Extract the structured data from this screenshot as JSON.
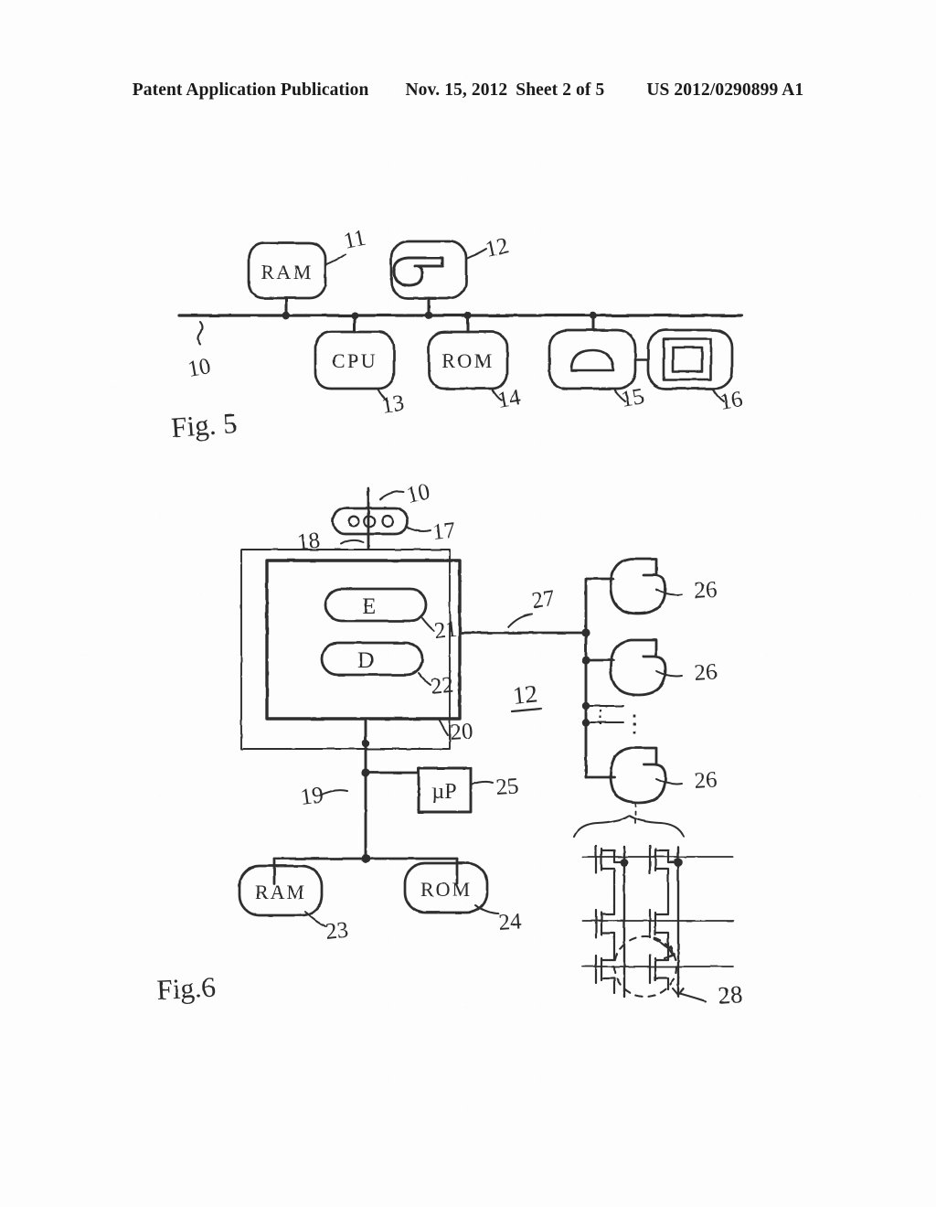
{
  "header": {
    "publication": "Patent Application Publication",
    "date": "Nov. 15, 2012",
    "sheet": "Sheet 2 of 5",
    "doc_number": "US 2012/0290899 A1"
  },
  "figures": [
    {
      "id": "fig5",
      "caption": "Fig. 5",
      "description": "Bus architecture block diagram",
      "bus_label": "10",
      "blocks": [
        {
          "ref": "11",
          "label": "RAM",
          "glyph": "text",
          "position": "above-bus"
        },
        {
          "ref": "12",
          "label": "",
          "glyph": "horn-icon",
          "position": "above-bus"
        },
        {
          "ref": "13",
          "label": "CPU",
          "glyph": "text",
          "position": "below-bus"
        },
        {
          "ref": "14",
          "label": "ROM",
          "glyph": "text",
          "position": "below-bus"
        },
        {
          "ref": "15",
          "label": "",
          "glyph": "dome-icon",
          "position": "below-bus"
        },
        {
          "ref": "16",
          "label": "",
          "glyph": "nested-square-icon",
          "position": "below-bus"
        }
      ]
    },
    {
      "id": "fig6",
      "caption": "Fig.6",
      "description": "Loudspeaker module detail block diagram",
      "assembly_label": "12",
      "blocks": [
        {
          "ref": "10",
          "label": "",
          "glyph": "bus-line",
          "note": "bus from Fig. 5"
        },
        {
          "ref": "17",
          "label": "",
          "glyph": "connector-icon",
          "note": "three-pin connector pill"
        },
        {
          "ref": "18",
          "label": "",
          "glyph": "outer-frame",
          "note": "thin outer rectangle"
        },
        {
          "ref": "20",
          "label": "",
          "glyph": "inner-frame",
          "note": "bold inner rectangle"
        },
        {
          "ref": "21",
          "label": "E",
          "glyph": "pill",
          "note": "encoder stage"
        },
        {
          "ref": "22",
          "label": "D",
          "glyph": "pill",
          "note": "decoder stage"
        },
        {
          "ref": "19",
          "label": "",
          "glyph": "bus-line",
          "note": "internal bus"
        },
        {
          "ref": "25",
          "label": "µP",
          "glyph": "square-box",
          "note": "microprocessor"
        },
        {
          "ref": "23",
          "label": "RAM",
          "glyph": "rounded-box"
        },
        {
          "ref": "24",
          "label": "ROM",
          "glyph": "rounded-box"
        },
        {
          "ref": "27",
          "label": "",
          "glyph": "signal-line",
          "note": "output line to transducers"
        },
        {
          "ref": "26",
          "label": "",
          "glyph": "horn-icon",
          "note": "transducer 1"
        },
        {
          "ref": "26",
          "label": "",
          "glyph": "horn-icon",
          "note": "transducer 2"
        },
        {
          "ref": "26",
          "label": "",
          "glyph": "horn-icon",
          "note": "transducer n"
        },
        {
          "ref": "28",
          "label": "",
          "glyph": "transistor-array",
          "note": "MOSFET cell array"
        }
      ],
      "ellipsis": "⋮"
    }
  ]
}
